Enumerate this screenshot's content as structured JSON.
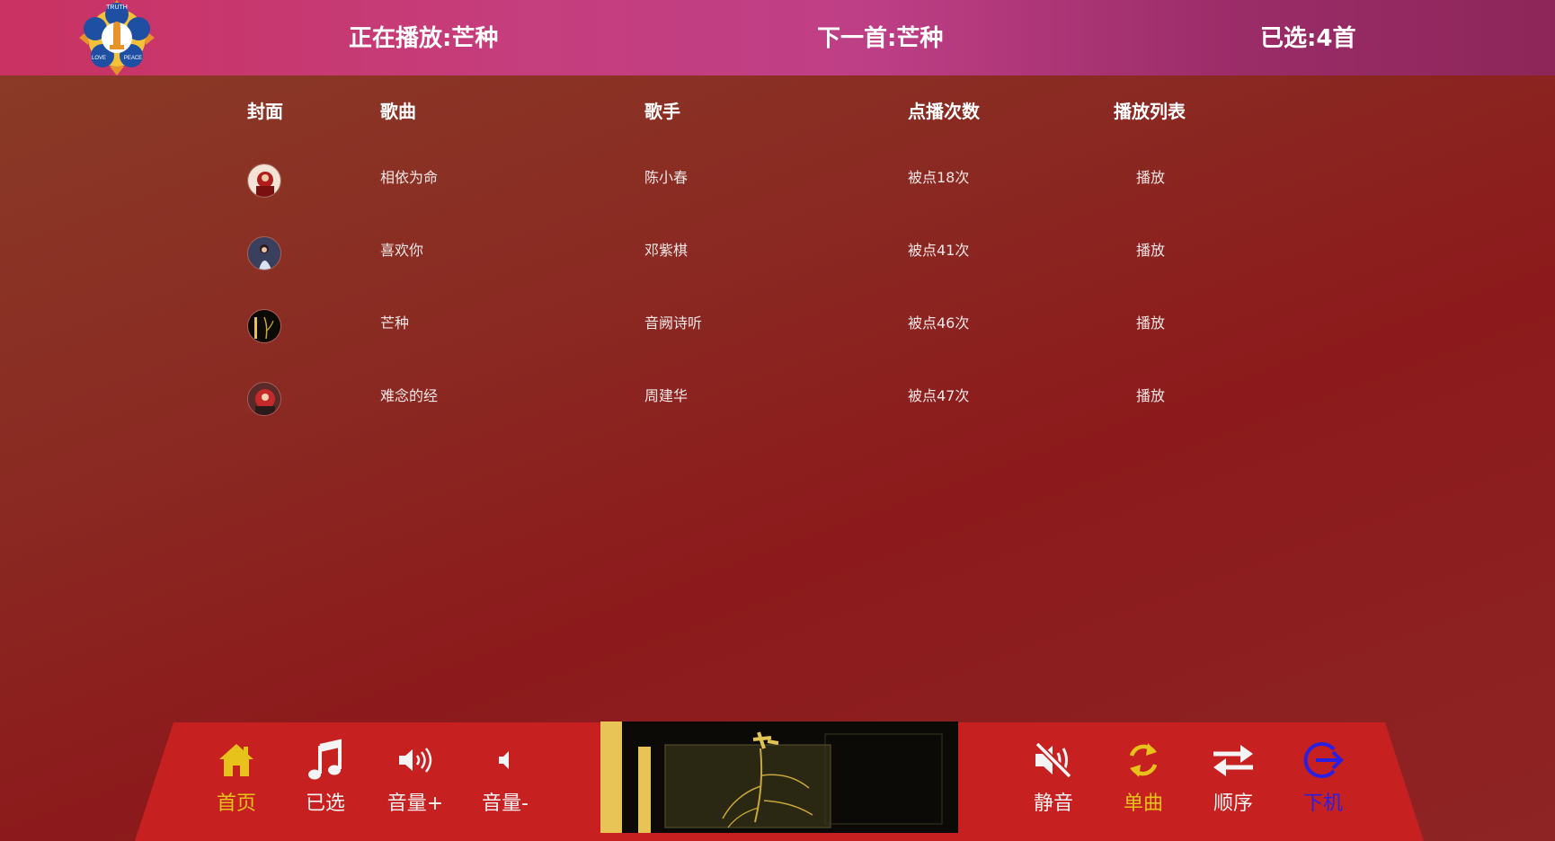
{
  "header": {
    "now_playing": "正在播放:芒种",
    "next_song": "下一首:芒种",
    "selected": "已选:4首",
    "logo_words": [
      "TRUTH",
      "LOVE",
      "PEACE"
    ]
  },
  "table": {
    "columns": {
      "cover": "封面",
      "song": "歌曲",
      "singer": "歌手",
      "play_count": "点播次数",
      "playlist": "播放列表"
    },
    "rows": [
      {
        "song": "相依为命",
        "singer": "陈小春",
        "count": "被点18次",
        "action": "播放"
      },
      {
        "song": "喜欢你",
        "singer": "邓紫棋",
        "count": "被点41次",
        "action": "播放"
      },
      {
        "song": "芒种",
        "singer": "音阙诗听",
        "count": "被点46次",
        "action": "播放"
      },
      {
        "song": "难念的经",
        "singer": "周建华",
        "count": "被点47次",
        "action": "播放"
      }
    ]
  },
  "controls": {
    "home": "首页",
    "selected": "已选",
    "volume_up": "音量+",
    "volume_down": "音量-",
    "mute": "静音",
    "single": "单曲",
    "order": "顺序",
    "logout": "下机"
  },
  "colors": {
    "accent_yellow": "#e6c21a",
    "bar_red": "#c62020",
    "header_pink": "#c53e7e",
    "logout_blue": "#2a1fe0"
  }
}
